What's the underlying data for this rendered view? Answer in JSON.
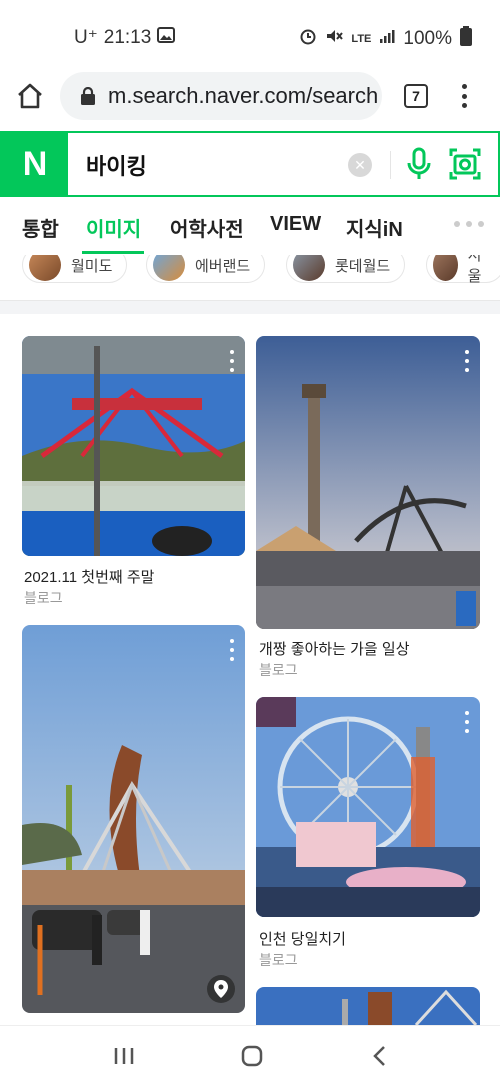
{
  "status_bar": {
    "carrier": "U⁺",
    "time": "21:13",
    "battery": "100%",
    "network": "LTE"
  },
  "browser": {
    "url": "m.search.naver.com/search",
    "tab_count": "7"
  },
  "search": {
    "logo": "N",
    "query": "바이킹"
  },
  "nav_tabs": [
    {
      "label": "통합"
    },
    {
      "label": "이미지"
    },
    {
      "label": "어학사전"
    },
    {
      "label": "VIEW"
    },
    {
      "label": "지식iN"
    }
  ],
  "chips": [
    {
      "label": "월미도"
    },
    {
      "label": "에버랜드"
    },
    {
      "label": "롯데월드"
    },
    {
      "label": "서울"
    }
  ],
  "results": [
    {
      "title": "2021.11 첫번째 주말",
      "source": "블로그"
    },
    {
      "title": "개짱 좋아하는 가을 일상",
      "source": "블로그"
    },
    {
      "title": "",
      "source": ""
    },
    {
      "title": "인천 당일치기",
      "source": "블로그"
    }
  ],
  "colors": {
    "brand": "#03c75a"
  }
}
